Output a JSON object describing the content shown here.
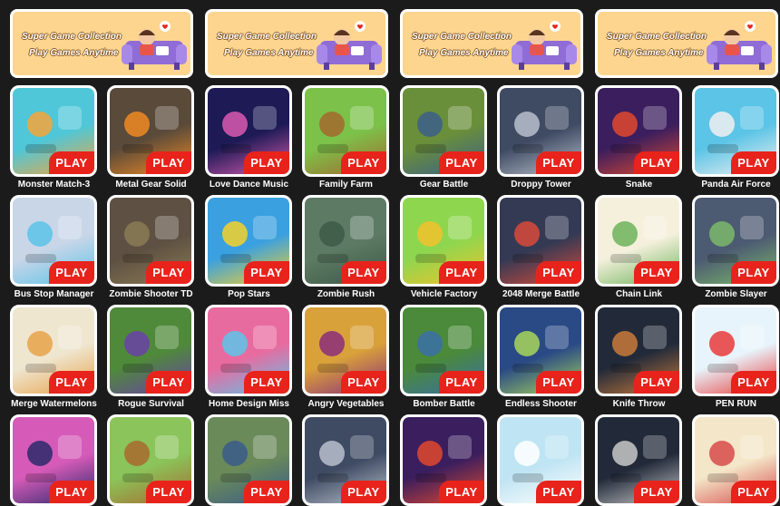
{
  "banner": {
    "line1": "Super Game Collection",
    "line2": "Play Games Anytime"
  },
  "play_label": "PLAY",
  "games": [
    {
      "name": "Monster Match-3",
      "bg": "#4fc7d8",
      "accent": "#f3a53b"
    },
    {
      "name": "Metal Gear Solid",
      "bg": "#5a4a3a",
      "accent": "#f08a24"
    },
    {
      "name": "Love Dance Music",
      "bg": "#1d1a55",
      "accent": "#d95bb0"
    },
    {
      "name": "Family Farm",
      "bg": "#7cc24a",
      "accent": "#a36a2e"
    },
    {
      "name": "Gear Battle",
      "bg": "#6a8f3a",
      "accent": "#3b5f8a"
    },
    {
      "name": "Droppy Tower",
      "bg": "#3f4b63",
      "accent": "#b8c0cc"
    },
    {
      "name": "Snake",
      "bg": "#3b1e5e",
      "accent": "#e0482e"
    },
    {
      "name": "Panda Air Force",
      "bg": "#5cc4e6",
      "accent": "#f0f0f0"
    },
    {
      "name": "Bus Stop Manager",
      "bg": "#c9d6e8",
      "accent": "#5bc3e8"
    },
    {
      "name": "Zombie Shooter TD",
      "bg": "#5e5042",
      "accent": "#8a7a55"
    },
    {
      "name": "Pop Stars",
      "bg": "#3aa0e0",
      "accent": "#f6d12a"
    },
    {
      "name": "Zombie Rush",
      "bg": "#5c7a64",
      "accent": "#3d5a46"
    },
    {
      "name": "Vehicle Factory",
      "bg": "#8fd64f",
      "accent": "#f1c22a"
    },
    {
      "name": "2048 Merge Battle",
      "bg": "#343a54",
      "accent": "#d84a3a"
    },
    {
      "name": "Chain Link",
      "bg": "#f4f0dc",
      "accent": "#6db35a"
    },
    {
      "name": "Zombie Slayer",
      "bg": "#4c5a72",
      "accent": "#7bb86a"
    },
    {
      "name": "Merge Watermelons",
      "bg": "#efe6d0",
      "accent": "#e8a24a"
    },
    {
      "name": "Rogue Survival",
      "bg": "#4f8a3a",
      "accent": "#6a3fa8"
    },
    {
      "name": "Home Design Miss",
      "bg": "#e86ba0",
      "accent": "#5dc4e8"
    },
    {
      "name": "Angry Vegetables",
      "bg": "#d9a13a",
      "accent": "#8a2e7a"
    },
    {
      "name": "Bomber Battle",
      "bg": "#4a8a3a",
      "accent": "#3b6ea8"
    },
    {
      "name": "Endless Shooter",
      "bg": "#2a4a86",
      "accent": "#a8d65a"
    },
    {
      "name": "Knife Throw",
      "bg": "#222a3a",
      "accent": "#c87a3a"
    },
    {
      "name": "PEN RUN",
      "bg": "#e8f4fb",
      "accent": "#e83a3a"
    },
    {
      "name": "",
      "bg": "#d65bb8",
      "accent": "#2a2a6a"
    },
    {
      "name": "",
      "bg": "#8ac45a",
      "accent": "#a86a2e"
    },
    {
      "name": "",
      "bg": "#6a8a5a",
      "accent": "#3a5a8a"
    },
    {
      "name": "",
      "bg": "#3f4b63",
      "accent": "#b8c0cc"
    },
    {
      "name": "",
      "bg": "#3b1e5e",
      "accent": "#e0482e"
    },
    {
      "name": "",
      "bg": "#bfe4f3",
      "accent": "#ffffff"
    },
    {
      "name": "",
      "bg": "#222a3a",
      "accent": "#c8c8c8"
    },
    {
      "name": "",
      "bg": "#f4e6c8",
      "accent": "#d64a4a"
    }
  ]
}
